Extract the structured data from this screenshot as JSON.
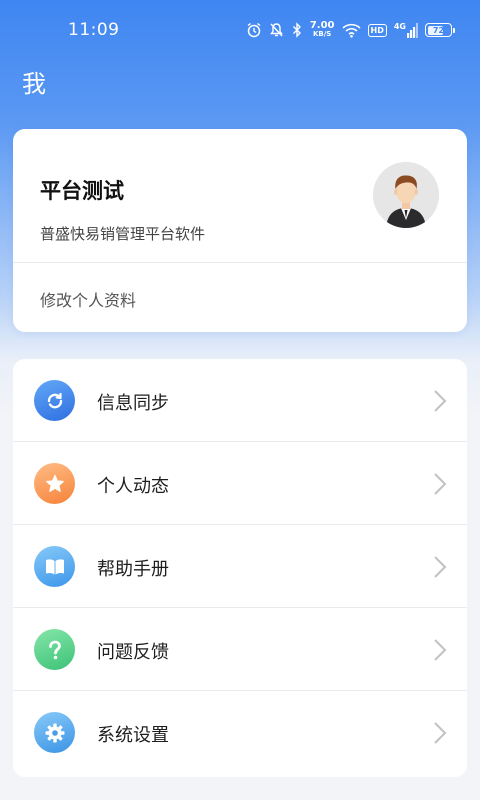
{
  "status_bar": {
    "time": "11:09",
    "net_speed": "7.00",
    "net_unit": "KB/S",
    "hd": "HD",
    "signal": "4G",
    "battery": "72",
    "battery_level": 0.72
  },
  "header": {
    "title": "我"
  },
  "profile": {
    "name": "平台测试",
    "subtitle": "普盛快易销管理平台软件",
    "edit_label": "修改个人资料"
  },
  "menu": {
    "items": [
      {
        "label": "信息同步",
        "icon": "sync-icon",
        "color_from": "#5aa2f5",
        "color_to": "#2f6fe0"
      },
      {
        "label": "个人动态",
        "icon": "star-icon",
        "color_from": "#ffb47a",
        "color_to": "#f7853e"
      },
      {
        "label": "帮助手册",
        "icon": "book-icon",
        "color_from": "#7cc3f7",
        "color_to": "#3d98ea"
      },
      {
        "label": "问题反馈",
        "icon": "question-icon",
        "color_from": "#7fe3a4",
        "color_to": "#3ec479"
      },
      {
        "label": "系统设置",
        "icon": "gear-icon",
        "color_from": "#7fc4f5",
        "color_to": "#3d95e6"
      }
    ]
  }
}
